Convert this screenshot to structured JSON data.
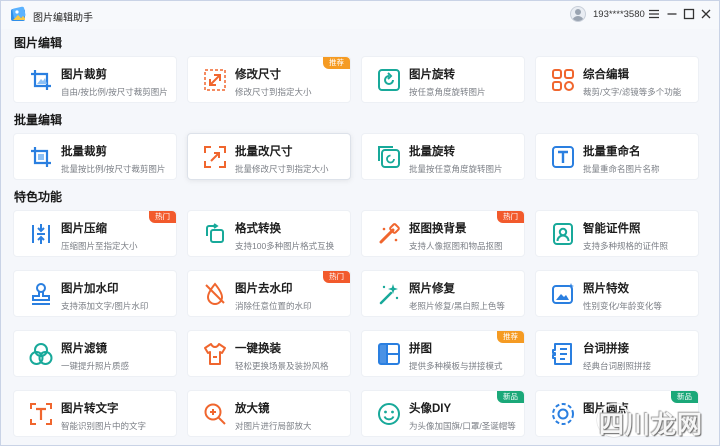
{
  "app": {
    "title": "图片编辑助手",
    "user_phone": "193****3580"
  },
  "sections": {
    "image_edit": "图片编辑",
    "batch_edit": "批量编辑",
    "featured": "特色功能"
  },
  "colors": {
    "accent_blue": "#2a7fe0",
    "accent_orange": "#f0662e",
    "accent_teal": "#18a99a",
    "badge_red": "#f25a2c",
    "badge_orange": "#f59b23",
    "badge_green": "#1ba879"
  },
  "cards": {
    "crop": {
      "title": "图片裁剪",
      "desc": "自由/按比例/按尺寸裁剪图片",
      "icon": "crop-icon"
    },
    "resize": {
      "title": "修改尺寸",
      "desc": "修改尺寸到指定大小",
      "badge": "推荐",
      "icon": "resize-icon"
    },
    "rotate": {
      "title": "图片旋转",
      "desc": "按任意角度旋转图片",
      "icon": "rotate-icon"
    },
    "combo": {
      "title": "综合编辑",
      "desc": "裁剪/文字/滤镜等多个功能",
      "icon": "combo-edit-icon"
    },
    "batch_crop": {
      "title": "批量裁剪",
      "desc": "批量按比例/按尺寸裁剪图片",
      "icon": "batch-crop-icon"
    },
    "batch_resize": {
      "title": "批量改尺寸",
      "desc": "批量修改尺寸到指定大小",
      "icon": "batch-resize-icon"
    },
    "batch_rotate": {
      "title": "批量旋转",
      "desc": "批量按任意角度旋转图片",
      "icon": "batch-rotate-icon"
    },
    "batch_rename": {
      "title": "批量重命名",
      "desc": "批量重命名图片名称",
      "icon": "batch-rename-icon"
    },
    "compress": {
      "title": "图片压缩",
      "desc": "压缩图片至指定大小",
      "badge": "热门",
      "icon": "compress-icon"
    },
    "convert": {
      "title": "格式转换",
      "desc": "支持100多种图片格式互换",
      "icon": "format-convert-icon"
    },
    "cutout": {
      "title": "抠图换背景",
      "desc": "支持人像抠图和物品抠图",
      "badge": "热门",
      "icon": "cutout-icon"
    },
    "id_photo": {
      "title": "智能证件照",
      "desc": "支持多种规格的证件照",
      "icon": "id-photo-icon"
    },
    "watermark_add": {
      "title": "图片加水印",
      "desc": "支持添加文字/图片水印",
      "icon": "stamp-icon"
    },
    "watermark_remove": {
      "title": "图片去水印",
      "desc": "消除任意位置的水印",
      "badge": "热门",
      "icon": "remove-watermark-icon"
    },
    "repair": {
      "title": "照片修复",
      "desc": "老照片修复/黑白照上色等",
      "icon": "magic-wand-icon"
    },
    "effects": {
      "title": "照片特效",
      "desc": "性别变化/年龄变化等",
      "icon": "photo-effect-icon"
    },
    "filter": {
      "title": "照片滤镜",
      "desc": "一键提升照片质感",
      "icon": "filter-icon"
    },
    "outfit": {
      "title": "一键换装",
      "desc": "轻松更换场景及装扮风格",
      "icon": "shirt-icon"
    },
    "collage": {
      "title": "拼图",
      "desc": "提供多种模板与拼接模式",
      "badge": "推荐",
      "icon": "collage-icon"
    },
    "caption": {
      "title": "台词拼接",
      "desc": "经典台词剧照拼接",
      "icon": "caption-icon"
    },
    "ocr": {
      "title": "图片转文字",
      "desc": "智能识别图片中的文字",
      "icon": "ocr-icon"
    },
    "magnify": {
      "title": "放大镜",
      "desc": "对图片进行局部放大",
      "icon": "magnifier-icon"
    },
    "avatar_diy": {
      "title": "头像DIY",
      "desc": "为头像加国旗/口罩/圣诞帽等",
      "badge": "新品",
      "icon": "smile-icon"
    },
    "dot": {
      "title": "图片圆点",
      "desc": "",
      "badge": "新品",
      "icon": "dot-icon"
    }
  },
  "watermark": {
    "text": "四川龙网"
  }
}
